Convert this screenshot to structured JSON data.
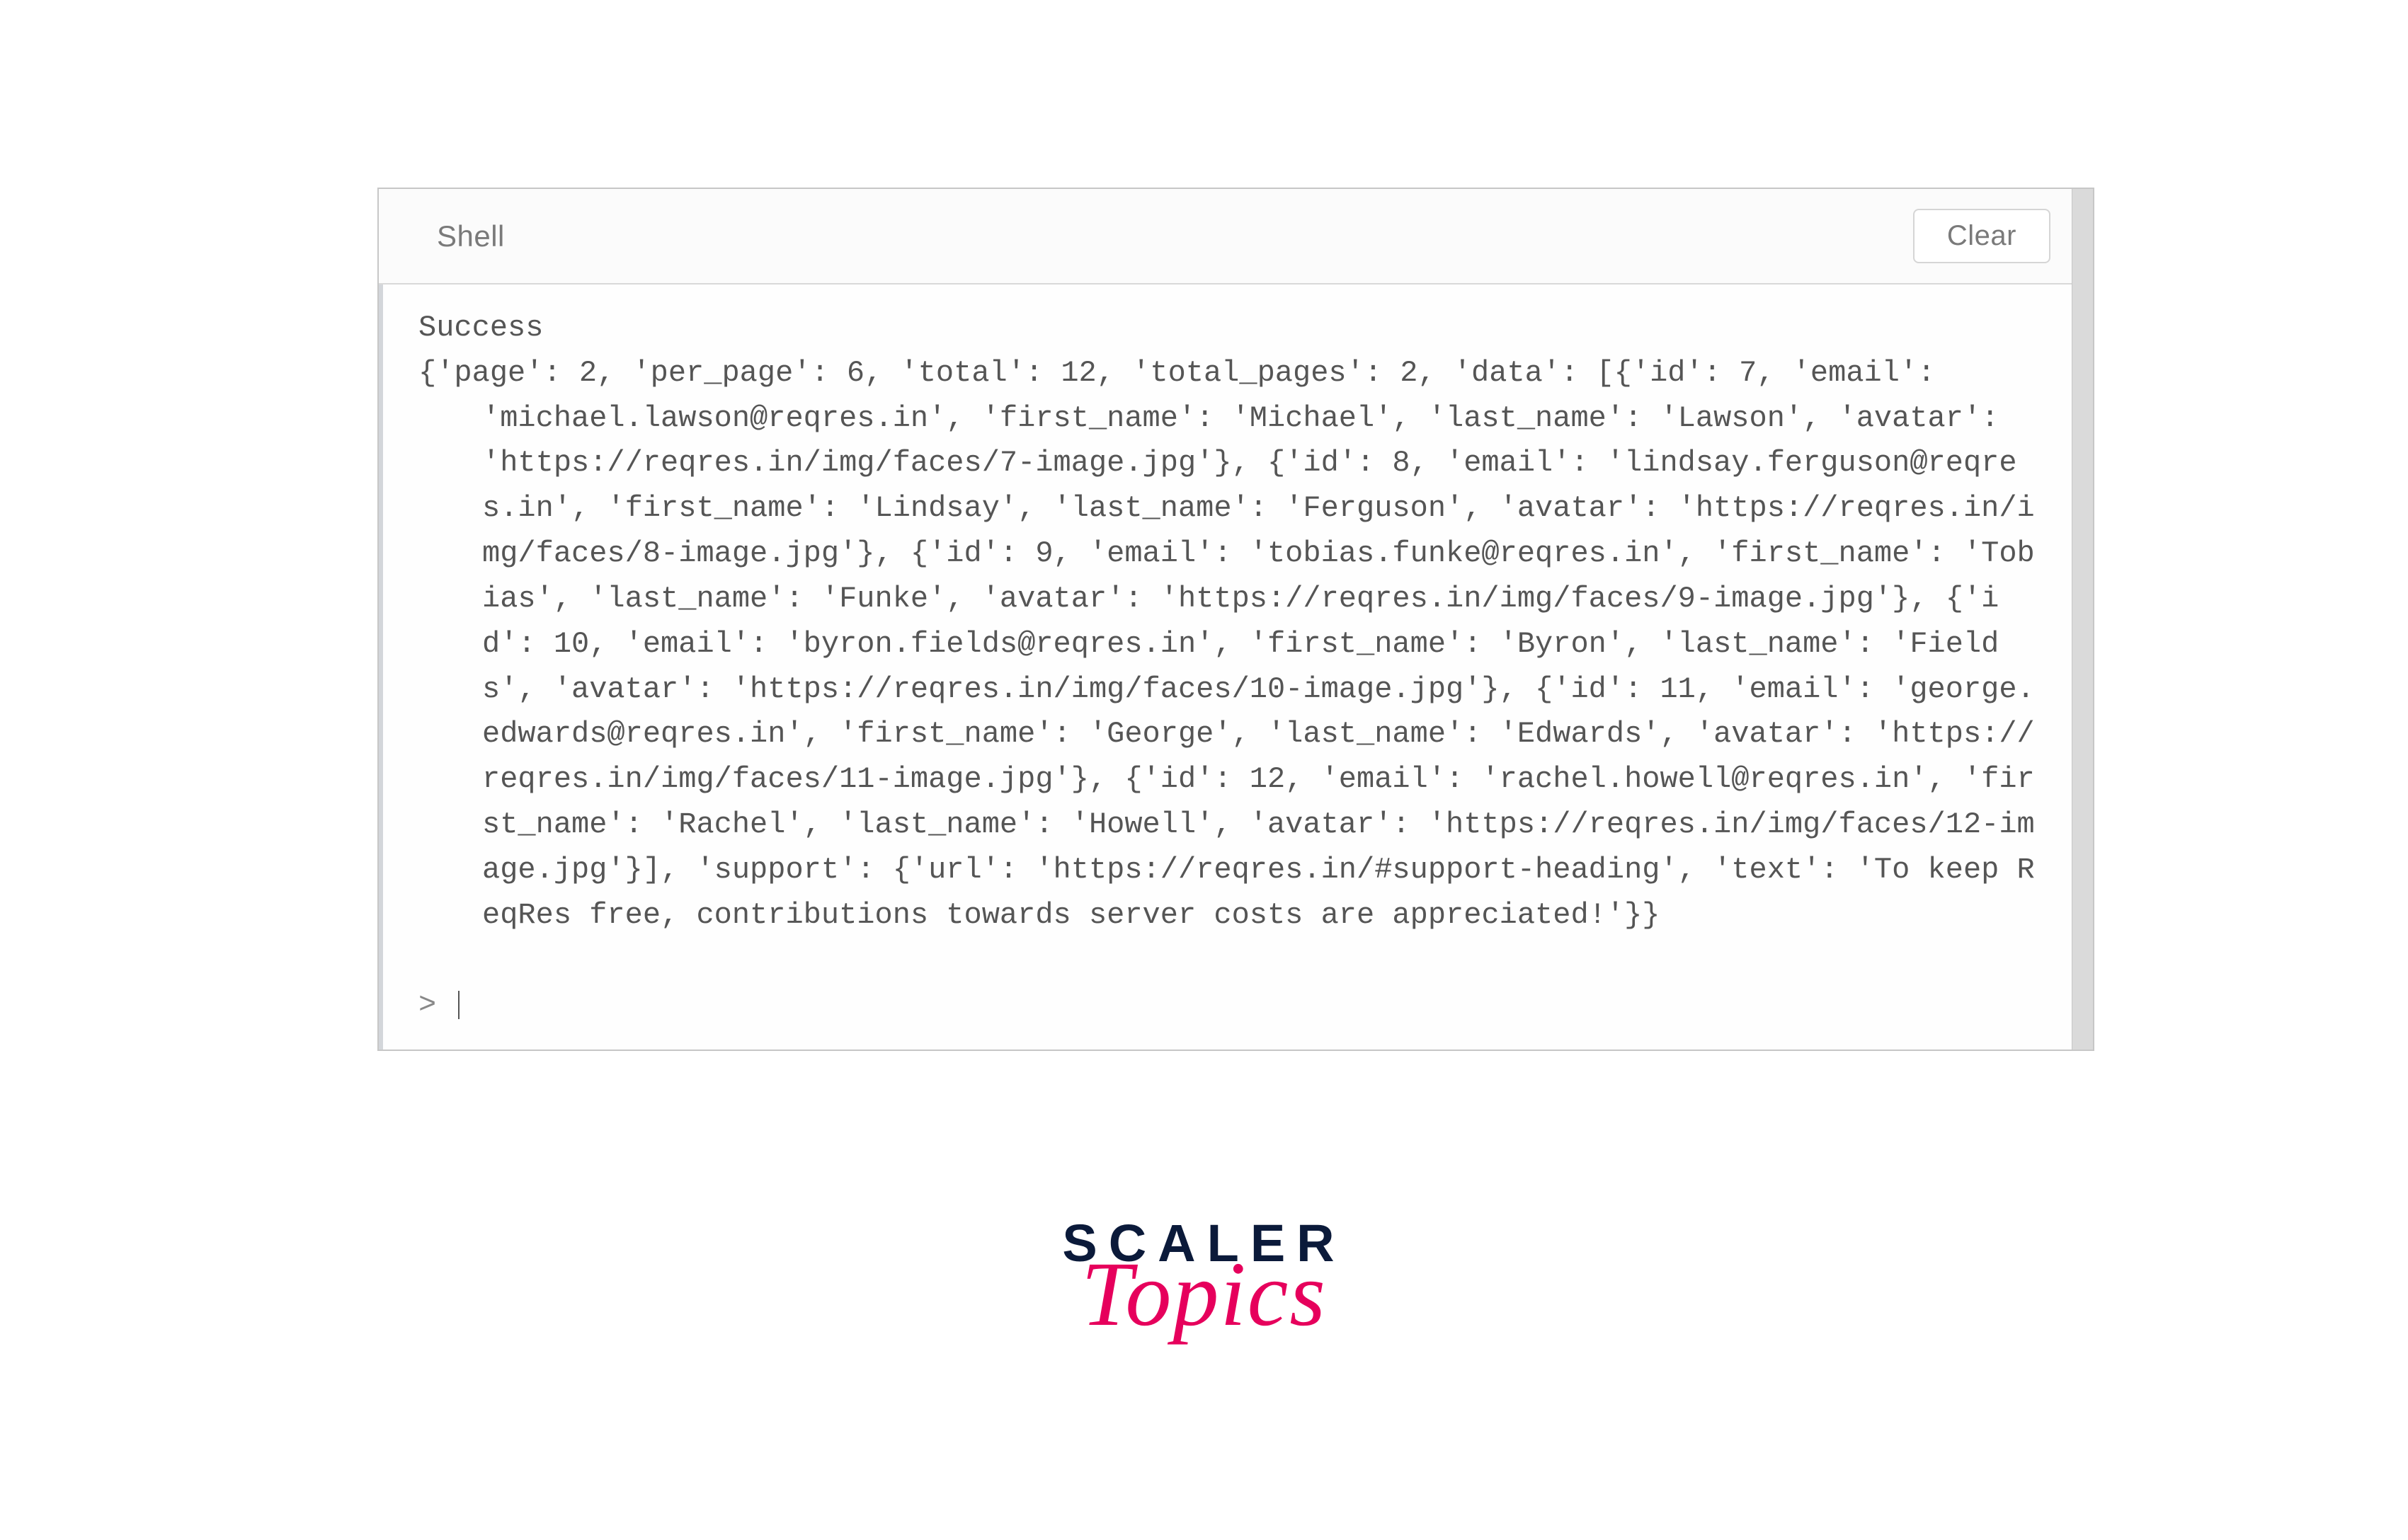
{
  "console": {
    "title": "Shell",
    "clear_label": "Clear",
    "status": "Success",
    "prompt": "> ",
    "output_first": "{'page': 2, 'per_page': 6, 'total': 12, 'total_pages': 2, 'data': [{'id': 7, 'email': ",
    "output_rest": "'michael.lawson@reqres.in', 'first_name': 'Michael', 'last_name': 'Lawson', 'avatar': 'https://reqres.in/img/faces/7-image.jpg'}, {'id': 8, 'email': 'lindsay.ferguson@reqres.in', 'first_name': 'Lindsay', 'last_name': 'Ferguson', 'avatar': 'https://reqres.in/img/faces/8-image.jpg'}, {'id': 9, 'email': 'tobias.funke@reqres.in', 'first_name': 'Tobias', 'last_name': 'Funke', 'avatar': 'https://reqres.in/img/faces/9-image.jpg'}, {'id': 10, 'email': 'byron.fields@reqres.in', 'first_name': 'Byron', 'last_name': 'Fields', 'avatar': 'https://reqres.in/img/faces/10-image.jpg'}, {'id': 11, 'email': 'george.edwards@reqres.in', 'first_name': 'George', 'last_name': 'Edwards', 'avatar': 'https://reqres.in/img/faces/11-image.jpg'}, {'id': 12, 'email': 'rachel.howell@reqres.in', 'first_name': 'Rachel', 'last_name': 'Howell', 'avatar': 'https://reqres.in/img/faces/12-image.jpg'}], 'support': {'url': 'https://reqres.in/#support-heading', 'text': 'To keep ReqRes free, contributions towards server costs are appreciated!'}}"
  },
  "branding": {
    "main": "SCALER",
    "sub": "Topics"
  }
}
